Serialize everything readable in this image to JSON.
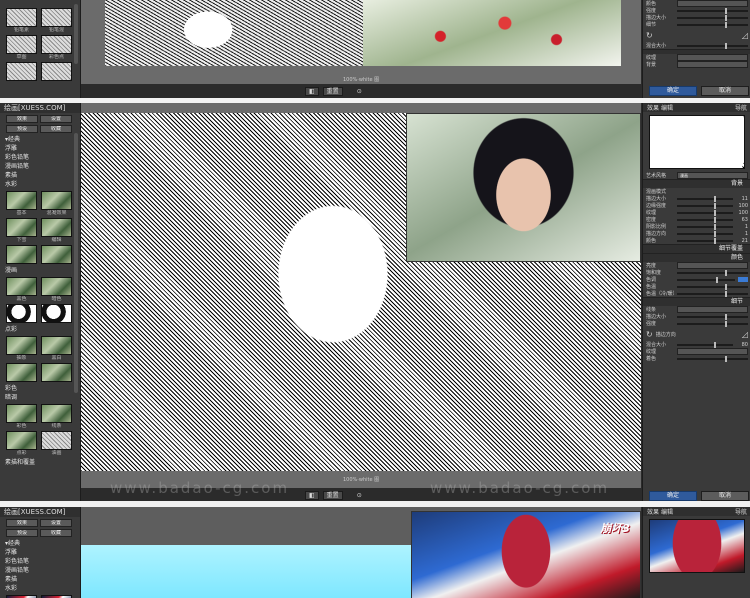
{
  "strip1": {
    "sidebar": {
      "title": "",
      "thumb_labels": [
        "铅笔素",
        "铅笔混",
        "草图",
        "彩色点",
        "",
        ""
      ]
    },
    "status": "100%·white 图",
    "bottom_buttons": [
      "◧",
      "重置",
      "⊙"
    ],
    "right_panel": {
      "rows": [
        {
          "label": "颜色",
          "value": ""
        },
        {
          "label": "强度",
          "value": ""
        },
        {
          "label": "描边大小",
          "value": ""
        },
        {
          "label": "细节",
          "value": ""
        },
        {
          "label": "",
          "value": ""
        },
        {
          "label": "混合大小",
          "value": ""
        },
        {
          "label": "纹理",
          "value": ""
        },
        {
          "label": "背景",
          "value": ""
        }
      ],
      "ok": "确定",
      "cancel": "取消"
    }
  },
  "strip2": {
    "sidebar": {
      "title": "绘画[XUESS.COM]",
      "tabs": [
        "效果",
        "设置",
        "预设",
        "收藏"
      ],
      "groups": [
        "▾经典",
        "浮雕",
        "彩色铅笔",
        "漫画铅笔",
        "素描",
        "水彩"
      ],
      "thumb_labels": [
        "基本",
        "混凝效果",
        "下雪",
        "编辑",
        "",
        "",
        "黑色",
        "暗色",
        "",
        "",
        "抽象",
        "黑白",
        "",
        "",
        "浅灰",
        "灰色",
        "彩色",
        "线条",
        "",
        "",
        "点彩",
        "油画",
        "",
        ""
      ],
      "sub_groups": [
        "漫画",
        "点彩",
        "彩色",
        "暗调",
        "漫画线条"
      ],
      "bottom_group": "素描和覆盖"
    },
    "status": "100%·white 图",
    "bottom_buttons": [
      "◧",
      "重置",
      "⊙"
    ],
    "right_panel": {
      "nav_label": "导航",
      "tab_labels": [
        "效果",
        "编辑"
      ],
      "art_mode_label": "艺术风格",
      "art_mode_value": "漫画",
      "bg_section": "背景",
      "bg_mode": "混画模式",
      "bg_rows": [
        {
          "label": "描边大小",
          "value": "11"
        },
        {
          "label": "边缘强度",
          "value": "100"
        },
        {
          "label": "纹理",
          "value": "100"
        },
        {
          "label": "密度",
          "value": "63"
        },
        {
          "label": "阴影比例",
          "value": "1"
        },
        {
          "label": "描边方向",
          "value": "1"
        },
        {
          "label": "颜色",
          "value": "21"
        }
      ],
      "style_section": "细节覆盖",
      "color_section": "颜色",
      "color_rows": [
        {
          "label": "亮度",
          "value": ""
        },
        {
          "label": "饱和度",
          "value": ""
        },
        {
          "label": "色调",
          "value": ""
        },
        {
          "label": "色温",
          "value": ""
        },
        {
          "label": "色温（冷/暖）",
          "value": ""
        }
      ],
      "detail_section": "细节",
      "detail_rows": [
        {
          "label": "线条",
          "value": ""
        },
        {
          "label": "描边大小",
          "value": ""
        },
        {
          "label": "强度",
          "value": ""
        },
        {
          "label": "描边方向",
          "value": ""
        },
        {
          "label": "混合大小",
          "value": "80"
        }
      ],
      "texture_rows": [
        {
          "label": "纹理",
          "value": ""
        },
        {
          "label": "着色",
          "value": ""
        },
        {
          "label": "",
          "value": ""
        }
      ],
      "ok": "确定",
      "cancel": "取消"
    }
  },
  "strip3": {
    "sidebar": {
      "title": "绘画[XUESS.COM]",
      "tabs": [
        "效果",
        "设置",
        "预设",
        "收藏"
      ],
      "groups": [
        "▾经典",
        "浮雕",
        "彩色铅笔",
        "漫画铅笔",
        "素描",
        "水彩"
      ]
    },
    "anime_logo": "崩坏3",
    "right_panel": {
      "nav_label": "导航",
      "tab_labels": [
        "效果",
        "编辑"
      ]
    }
  },
  "watermark": "www.badao-cg.com"
}
